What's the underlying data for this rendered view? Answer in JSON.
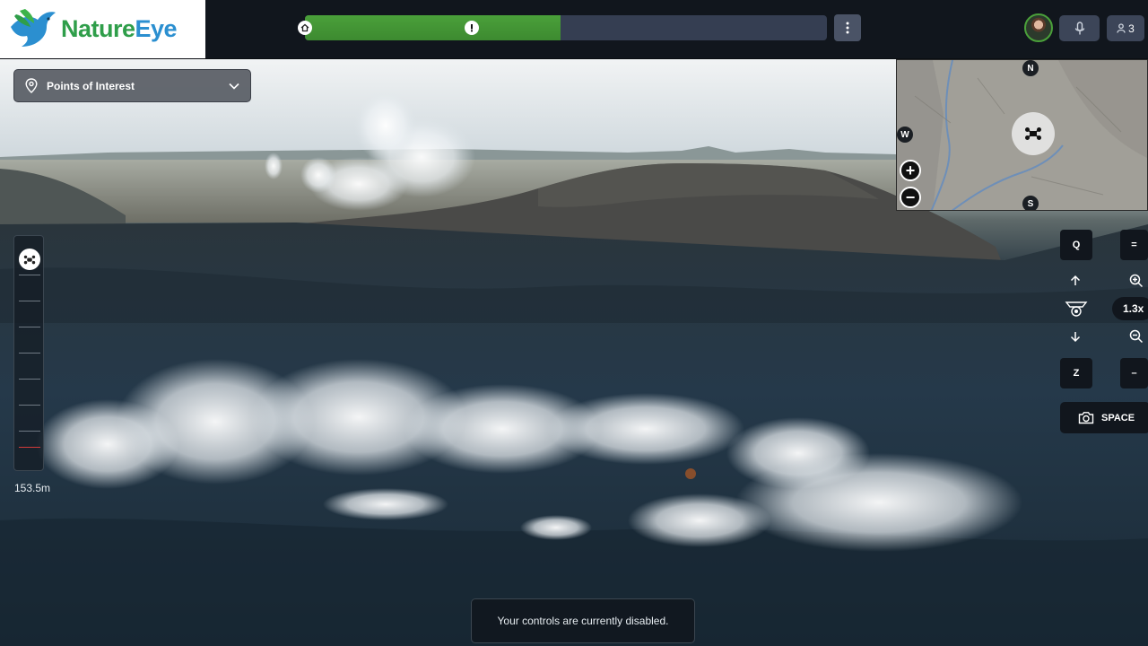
{
  "app": {
    "brand_part1": "Nature",
    "brand_part2": "Eye",
    "brand_green": "#2f9e4a",
    "brand_blue": "#2b8fd0",
    "accent_green": "#4aa03a"
  },
  "timeline": {
    "progress_fraction": 0.49,
    "alert_position_fraction": 0.32,
    "home_icon": "home-icon",
    "alert_icon": "exclamation-icon"
  },
  "topbar": {
    "menu_icon": "vertical-dots-icon",
    "mic_icon": "microphone-icon",
    "users_icon": "user-icon",
    "participant_count": "3"
  },
  "poi": {
    "label": "Points of Interest",
    "icon": "map-pin-icon"
  },
  "minimap": {
    "north": "N",
    "south": "S",
    "west": "W",
    "zoom_in": "+",
    "zoom_out": "−",
    "marker_icon": "drone-icon"
  },
  "altitude": {
    "value": "153.5m",
    "level_fraction": 0.0
  },
  "controls": {
    "key_q": "Q",
    "key_z": "Z",
    "key_equals": "=",
    "key_minus": "–",
    "zoom_level": "1.3x",
    "space_label": "SPACE"
  },
  "status": {
    "message": "Your controls are currently disabled."
  }
}
